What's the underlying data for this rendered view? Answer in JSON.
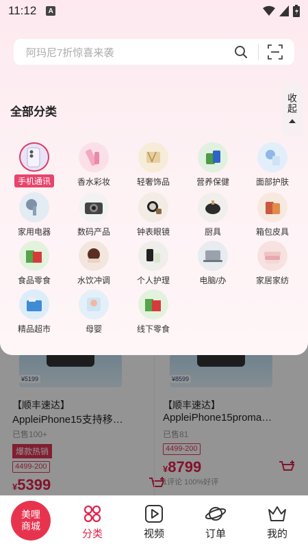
{
  "status_bar": {
    "time": "11:12"
  },
  "search": {
    "placeholder": "阿玛尼7折惊喜来袭"
  },
  "categories_title": "全部分类",
  "collapse_label": "收起",
  "categories": [
    {
      "label": "手机通讯",
      "active": true
    },
    {
      "label": "香水彩妆"
    },
    {
      "label": "轻奢饰品"
    },
    {
      "label": "营养保健"
    },
    {
      "label": "面部护肤"
    },
    {
      "label": "家用电器"
    },
    {
      "label": "数码产品"
    },
    {
      "label": "钟表眼镜"
    },
    {
      "label": "厨具"
    },
    {
      "label": "箱包皮具"
    },
    {
      "label": "食品零食"
    },
    {
      "label": "水饮冲调"
    },
    {
      "label": "个人护理"
    },
    {
      "label": "电脑/办"
    },
    {
      "label": "家居家纺"
    },
    {
      "label": "精品超市"
    },
    {
      "label": "母婴"
    },
    {
      "label": "线下零食"
    }
  ],
  "products": [
    {
      "img_price": "¥5199",
      "tag": "【顺丰速达】",
      "title": "AppleiPhone15支持移…",
      "sold": "已售100+",
      "badge": "爆款热销",
      "coupon": "4499-200",
      "price_symbol": "¥",
      "price": "5399"
    },
    {
      "img_price": "¥8599",
      "tag": "【顺丰速达】",
      "title": "AppleiPhone15proma…",
      "sold": "已售81",
      "coupon": "4499-200",
      "price_symbol": "¥",
      "price": "8799",
      "comment": "1评论 100%好评"
    }
  ],
  "bottom_nav": {
    "home_label": "美哩商城",
    "items": [
      "分类",
      "视频",
      "订单",
      "我的"
    ]
  },
  "colors": {
    "accent": "#e0224a",
    "panel_bg": "#fde9ef"
  }
}
